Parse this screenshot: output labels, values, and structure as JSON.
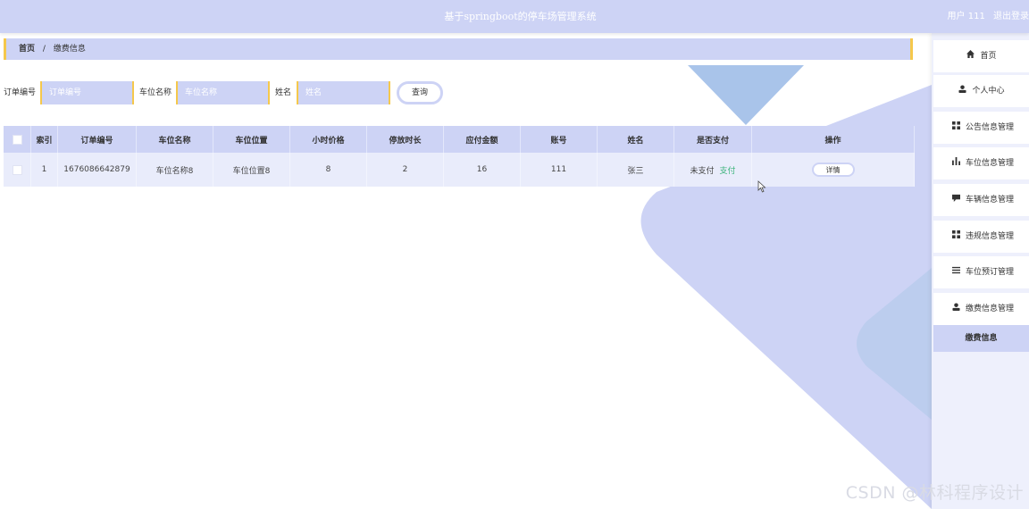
{
  "header": {
    "title": "基于springboot的停车场管理系统",
    "user_label": "用户 111",
    "logout_label": "退出登录"
  },
  "breadcrumb": {
    "home": "首页",
    "separator": "/",
    "current": "缴费信息"
  },
  "search": {
    "order_label": "订单编号",
    "order_placeholder": "订单编号",
    "space_label": "车位名称",
    "space_placeholder": "车位名称",
    "name_label": "姓名",
    "name_placeholder": "姓名",
    "query_button": "查询"
  },
  "table": {
    "headers": [
      "索引",
      "订单编号",
      "车位名称",
      "车位位置",
      "小时价格",
      "停放时长",
      "应付金额",
      "账号",
      "姓名",
      "是否支付",
      "操作"
    ],
    "rows": [
      {
        "index": "1",
        "order_no": "1676086642879",
        "space_name": "车位名称8",
        "space_location": "车位位置8",
        "hour_price": "8",
        "duration": "2",
        "amount": "16",
        "account": "111",
        "name": "张三",
        "paid_status": "未支付",
        "pay_action": "支付",
        "detail_button": "详情"
      }
    ]
  },
  "sidebar": {
    "items": [
      {
        "label": "首页",
        "icon": "home-icon"
      },
      {
        "label": "个人中心",
        "icon": "user-icon"
      },
      {
        "label": "公告信息管理",
        "icon": "grid-icon"
      },
      {
        "label": "车位信息管理",
        "icon": "bar-chart-icon"
      },
      {
        "label": "车辆信息管理",
        "icon": "chat-icon"
      },
      {
        "label": "违规信息管理",
        "icon": "grid-icon"
      },
      {
        "label": "车位预订管理",
        "icon": "list-icon"
      },
      {
        "label": "缴费信息管理",
        "icon": "user-icon"
      }
    ],
    "submenu": "缴费信息"
  },
  "watermark": "CSDN @林科程序设计",
  "colors": {
    "accent": "#cdd3f5",
    "border_accent": "#f5c84c",
    "decor_blue": "#a9c4ea",
    "pay_link": "#3bb37a"
  }
}
